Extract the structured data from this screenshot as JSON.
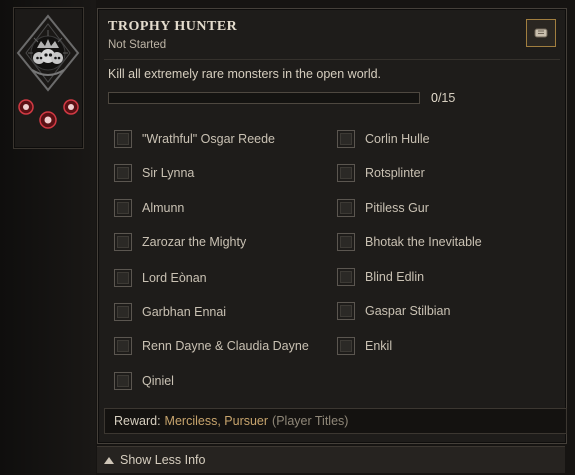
{
  "achievement": {
    "title": "TROPHY HUNTER",
    "status": "Not Started",
    "description": "Kill all extremely rare monsters in the open world.",
    "icon": "skull-crown-emblem"
  },
  "progress": {
    "current": "0",
    "total": "/15",
    "fraction": 0
  },
  "buttons": {
    "shrink_icon": "scroll-icon"
  },
  "checklist": {
    "left": [
      {
        "label": "\"Wrathful\" Osgar Reede",
        "checked": false
      },
      {
        "label": "Sir Lynna",
        "checked": false
      },
      {
        "label": "Almunn",
        "checked": false
      },
      {
        "label": "Zarozar the Mighty",
        "checked": false
      },
      {
        "label": "Lord Eònan",
        "checked": false
      },
      {
        "label": "Garbhan Ennai",
        "checked": false
      },
      {
        "label": "Renn Dayne & Claudia Dayne",
        "checked": false
      },
      {
        "label": "Qiniel",
        "checked": false
      }
    ],
    "right": [
      {
        "label": "Corlin Hulle",
        "checked": false
      },
      {
        "label": "Rotsplinter",
        "checked": false
      },
      {
        "label": "Pitiless Gur",
        "checked": false
      },
      {
        "label": "Bhotak the Inevitable",
        "checked": false
      },
      {
        "label": "Blind Edlin",
        "checked": false
      },
      {
        "label": "Gaspar Stilbian",
        "checked": false
      },
      {
        "label": "Enkil",
        "checked": false
      }
    ]
  },
  "reward": {
    "label": "Reward:",
    "value": "Merciless, Pursuer",
    "type": "(Player Titles)"
  },
  "footer": {
    "label": "Show Less Info",
    "icon": "chevron-up-icon"
  },
  "colors": {
    "accent": "#a17e3f",
    "reward": "#c7a46d",
    "panel": "#1e1c1a"
  }
}
